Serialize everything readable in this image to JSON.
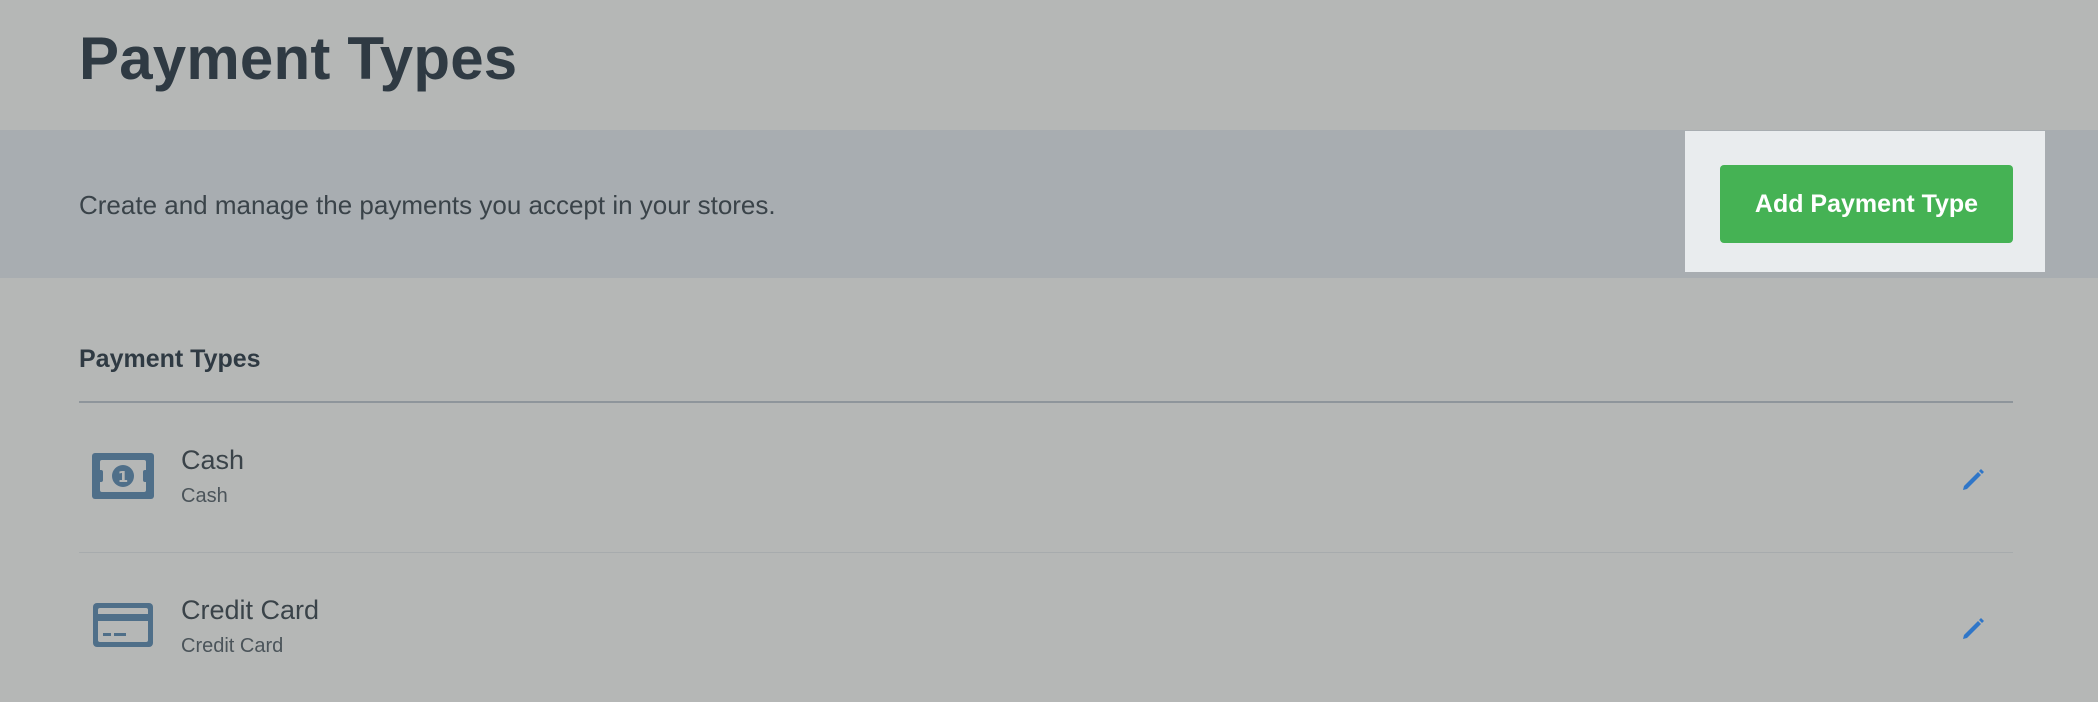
{
  "header": {
    "title": "Payment Types"
  },
  "banner": {
    "description": "Create and manage the payments you accept in your stores.",
    "add_button_label": "Add Payment Type"
  },
  "list": {
    "title": "Payment Types",
    "items": [
      {
        "name": "Cash",
        "type": "Cash",
        "icon": "cash-icon"
      },
      {
        "name": "Credit Card",
        "type": "Credit Card",
        "icon": "credit-card-icon"
      }
    ]
  },
  "colors": {
    "button_green": "#45b254",
    "icon_blue": "#4f6f89",
    "edit_blue": "#2f76c8"
  }
}
